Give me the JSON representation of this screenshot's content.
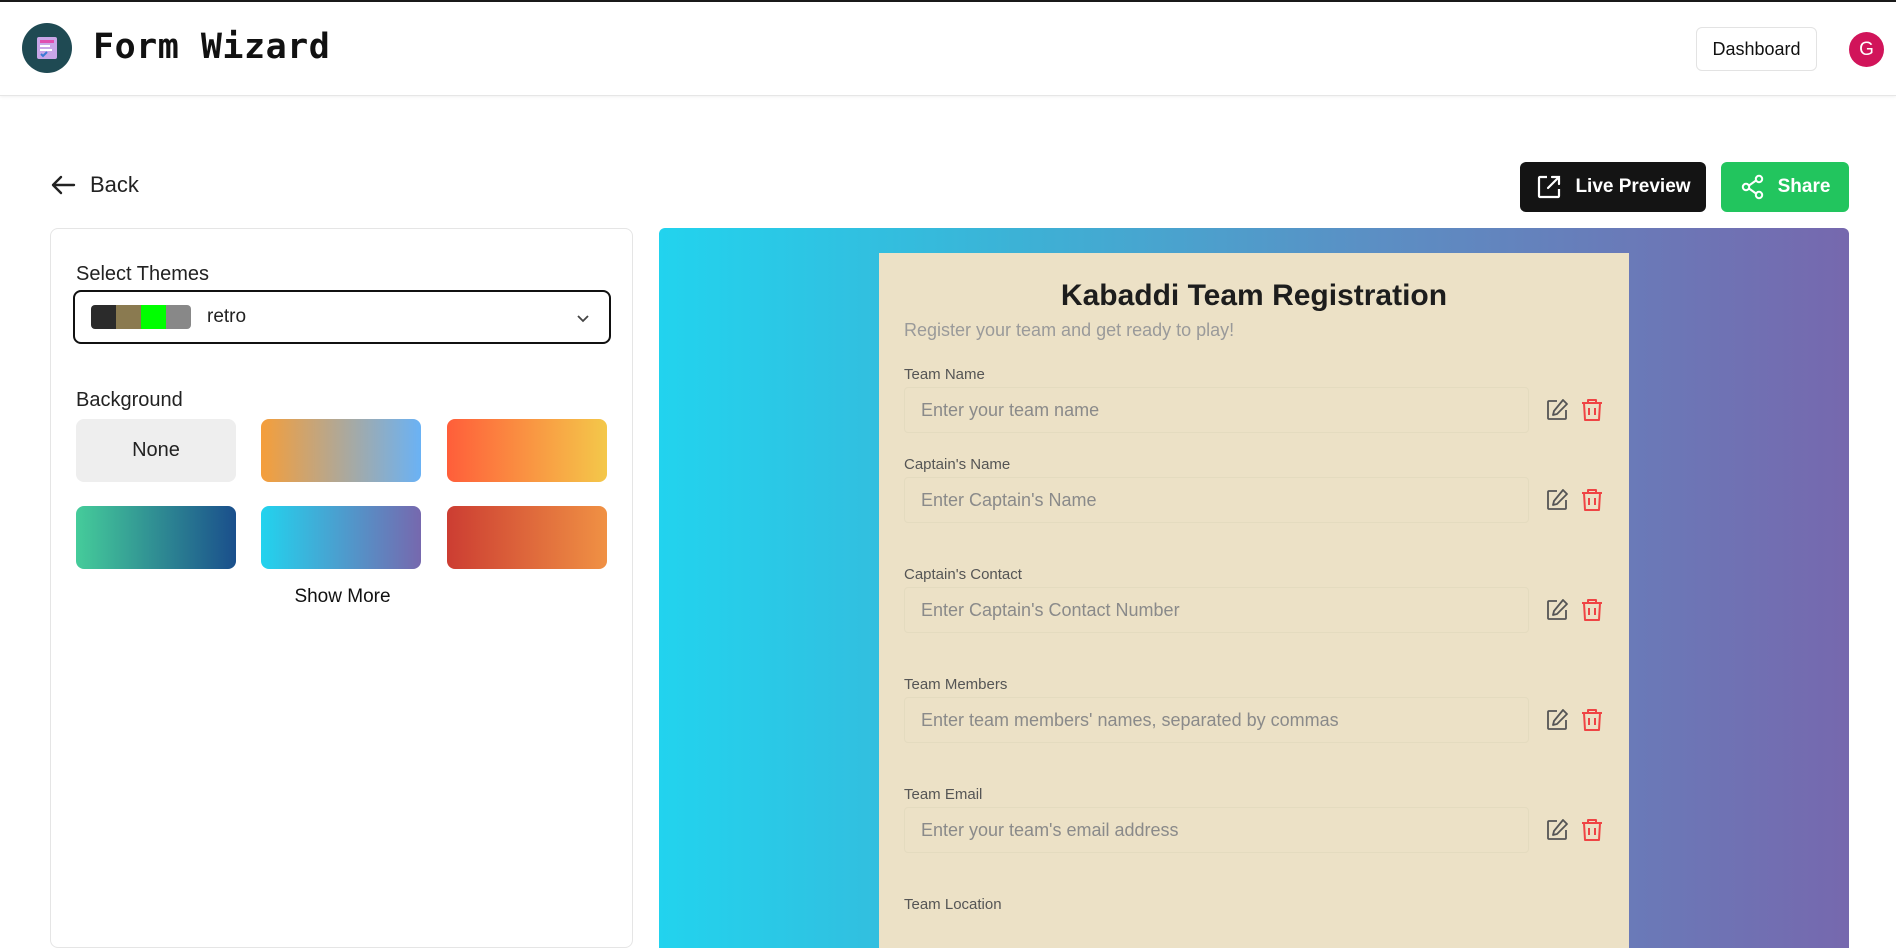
{
  "header": {
    "app_title": "Form Wizard",
    "logo_icon": "form-logo-icon",
    "dashboard_label": "Dashboard",
    "avatar_initial": "G",
    "avatar_color": "#d1145a"
  },
  "toolbar": {
    "back_label": "Back",
    "live_preview_label": "Live Preview",
    "share_label": "Share",
    "share_color": "#22c55e"
  },
  "sidebar": {
    "themes_label": "Select Themes",
    "selected_theme": "retro",
    "theme_swatches": [
      "#2b2b2b",
      "#8a7a50",
      "#00ff00",
      "#888888"
    ],
    "background_label": "Background",
    "background_none_label": "None",
    "background_options": [
      {
        "name": "orange-blue",
        "colors": [
          "#f59e3a",
          "#6ab2f5"
        ]
      },
      {
        "name": "orange-yellow",
        "colors": [
          "#ff5e3a",
          "#f4c84a"
        ]
      },
      {
        "name": "green-navy",
        "colors": [
          "#45cc9a",
          "#1a4f8c"
        ]
      },
      {
        "name": "cyan-purple",
        "colors": [
          "#22d3ee",
          "#7668ae"
        ]
      },
      {
        "name": "red-orange",
        "colors": [
          "#cc3d32",
          "#f09144"
        ]
      }
    ],
    "show_more_label": "Show More"
  },
  "form": {
    "title": "Kabaddi Team Registration",
    "subtitle": "Register your team and get ready to play!",
    "card_color": "#ece1c6",
    "fields": [
      {
        "label": "Team Name",
        "placeholder": "Enter your team name"
      },
      {
        "label": "Captain's Name",
        "placeholder": "Enter Captain's Name"
      },
      {
        "label": "Captain's Contact",
        "placeholder": "Enter Captain's Contact Number"
      },
      {
        "label": "Team Members",
        "placeholder": "Enter team members' names, separated by commas"
      },
      {
        "label": "Team Email",
        "placeholder": "Enter your team's email address"
      },
      {
        "label": "Team Location",
        "placeholder": ""
      }
    ]
  }
}
